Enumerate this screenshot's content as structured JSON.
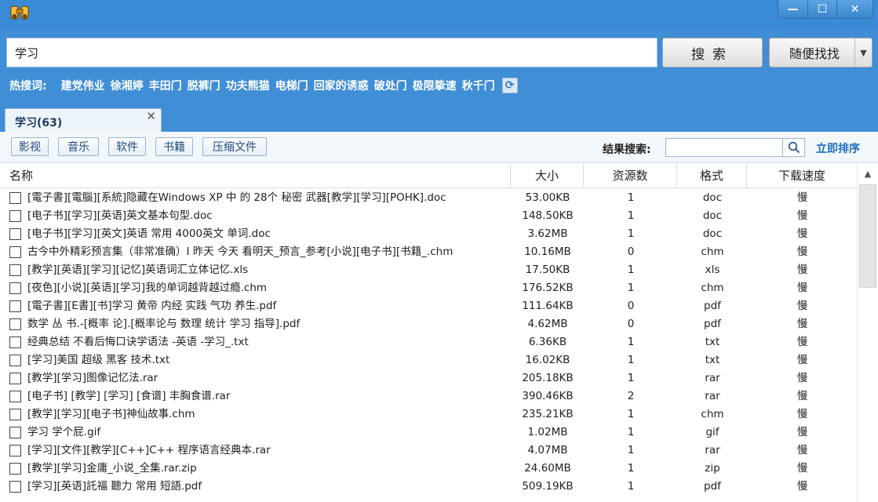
{
  "window": {
    "app_icon": "binoculars-icon",
    "minimize": "—",
    "maximize": "☐",
    "close": "✕"
  },
  "search": {
    "query": "学习",
    "search_label": "搜索",
    "random_label": "随便找找",
    "dropdown_arrow": "▼"
  },
  "hot": {
    "label": "热搜词:",
    "words": [
      "建党伟业",
      "徐湘婷",
      "丰田门",
      "脱裤门",
      "功夫熊猫",
      "电梯门",
      "回家的诱惑",
      "破处门",
      "极限挚速",
      "秋千门"
    ],
    "refresh_icon": "refresh-icon"
  },
  "tab": {
    "label": "学习(63)",
    "close": "✕"
  },
  "filters": [
    "影视",
    "音乐",
    "软件",
    "书籍",
    "压缩文件"
  ],
  "result_search": {
    "label": "结果搜索:",
    "value": "",
    "sort_label": "立即排序"
  },
  "table": {
    "headers": [
      "名称",
      "大小",
      "资源数",
      "格式",
      "下载速度"
    ],
    "rows": [
      {
        "name": "[電子書][電腦][系統]隐藏在Windows XP 中 的 28个 秘密 武器[教学][学习][POHK].doc",
        "size": "53.00KB",
        "sources": "1",
        "format": "doc",
        "speed": "慢"
      },
      {
        "name": "[电子书][学习][英语]英文基本句型.doc",
        "size": "148.50KB",
        "sources": "1",
        "format": "doc",
        "speed": "慢"
      },
      {
        "name": "[电子书][学习][英文]英语 常用 4000英文 单词.doc",
        "size": "3.62MB",
        "sources": "1",
        "format": "doc",
        "speed": "慢"
      },
      {
        "name": "古今中外精彩预言集（非常准确）I 昨天 今天 看明天_预言_参考[小说][电子书][书籍_.chm",
        "size": "10.16MB",
        "sources": "0",
        "format": "chm",
        "speed": "慢"
      },
      {
        "name": "[教学][英语][学习][记忆]英语词汇立体记忆.xls",
        "size": "17.50KB",
        "sources": "1",
        "format": "xls",
        "speed": "慢"
      },
      {
        "name": "[夜色][小说][英语][学习]我的单词越背越过瘾.chm",
        "size": "176.52KB",
        "sources": "1",
        "format": "chm",
        "speed": "慢"
      },
      {
        "name": "[電子書][E書][书]学习 黄帝 内经 实践 气功 养生.pdf",
        "size": "111.64KB",
        "sources": "0",
        "format": "pdf",
        "speed": "慢"
      },
      {
        "name": "数学 丛 书.-[概率 论].[概率论与 数理 统计 学习 指导].pdf",
        "size": "4.62MB",
        "sources": "0",
        "format": "pdf",
        "speed": "慢"
      },
      {
        "name": "经典总结 不看后悔口诀学语法 -英语 -学习_.txt",
        "size": "6.36KB",
        "sources": "1",
        "format": "txt",
        "speed": "慢"
      },
      {
        "name": "[学习]美国 超级 黑客 技术.txt",
        "size": "16.02KB",
        "sources": "1",
        "format": "txt",
        "speed": "慢"
      },
      {
        "name": "[教学][学习]图像记忆法.rar",
        "size": "205.18KB",
        "sources": "1",
        "format": "rar",
        "speed": "慢"
      },
      {
        "name": "[电子书] [教学] [学习] [食谱] 丰胸食谱.rar",
        "size": "390.46KB",
        "sources": "2",
        "format": "rar",
        "speed": "慢"
      },
      {
        "name": "[教学][学习][电子书]神仙故事.chm",
        "size": "235.21KB",
        "sources": "1",
        "format": "chm",
        "speed": "慢"
      },
      {
        "name": "学习 学个屁.gif",
        "size": "1.02MB",
        "sources": "1",
        "format": "gif",
        "speed": "慢"
      },
      {
        "name": "[学习][文件][教学][C++]C++ 程序语言经典本.rar",
        "size": "4.07MB",
        "sources": "1",
        "format": "rar",
        "speed": "慢"
      },
      {
        "name": "[教学][学习]金庸_小说_全集.rar.zip",
        "size": "24.60MB",
        "sources": "1",
        "format": "zip",
        "speed": "慢"
      },
      {
        "name": "[学习][英语]託福 聽力 常用 短語.pdf",
        "size": "509.19KB",
        "sources": "1",
        "format": "pdf",
        "speed": "慢"
      }
    ]
  }
}
